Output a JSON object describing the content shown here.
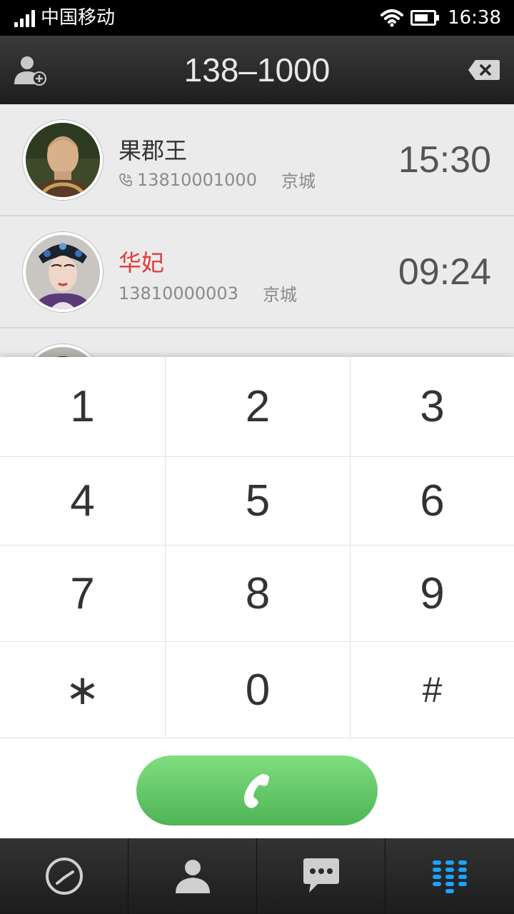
{
  "status_bar": {
    "carrier": "中国移动",
    "time": "16:38"
  },
  "header": {
    "dialed_number": "138–1000"
  },
  "results": [
    {
      "name": "果郡王",
      "number": "13810001000",
      "location": "京城",
      "time": "15:30",
      "highlight": false
    },
    {
      "name": "华妃",
      "number": "13810000003",
      "location": "京城",
      "time": "09:24",
      "highlight": true
    }
  ],
  "keypad": {
    "k1": "1",
    "k2": "2",
    "k3": "3",
    "k4": "4",
    "k5": "5",
    "k6": "6",
    "k7": "7",
    "k8": "8",
    "k9": "9",
    "kstar": "∗",
    "k0": "0",
    "khash": "#"
  },
  "colors": {
    "call_green": "#5cc162",
    "active_tab_blue": "#1aa3ff",
    "highlight_red": "#e23a3a"
  },
  "tabs": [
    "recent-calls",
    "contacts",
    "messages",
    "dialpad"
  ],
  "active_tab": "dialpad"
}
